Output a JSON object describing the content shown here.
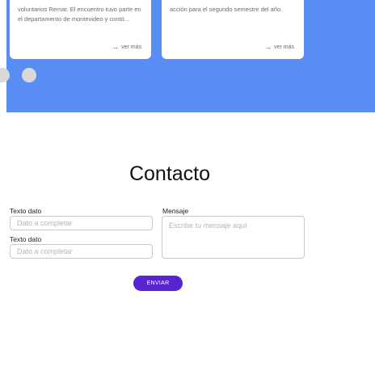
{
  "cards": [
    {
      "text": "voluntarios Remar. El encuentro tuvo parte en el departamento de montevideo y contó...",
      "link": "ver más"
    },
    {
      "text": "acción para el segundo semestre del año.",
      "link": "ver más"
    }
  ],
  "carousel": {
    "dots": 2
  },
  "contact": {
    "title": "Contacto",
    "field1": {
      "label": "Texto dato",
      "placeholder": "Dato a completar"
    },
    "field2": {
      "label": "Texto dato",
      "placeholder": "Dato a completar"
    },
    "message": {
      "label": "Mensaje",
      "placeholder": "Escribe tu mensaje aquí"
    },
    "submit_label": "ENVIAR"
  },
  "colors": {
    "hero_bg": "#5a8df4",
    "button_bg": "#5a23d1",
    "dot": "#d9d9d9"
  }
}
